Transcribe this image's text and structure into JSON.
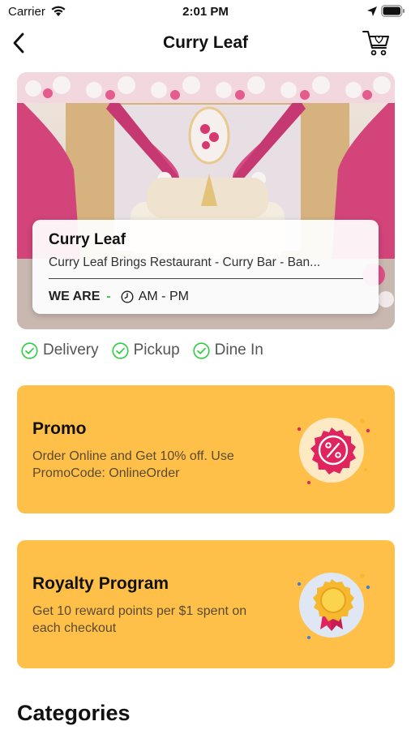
{
  "status_bar": {
    "carrier": "Carrier",
    "time": "2:01 PM"
  },
  "nav": {
    "title": "Curry Leaf"
  },
  "restaurant": {
    "name": "Curry Leaf",
    "description": "Curry Leaf Brings Restaurant - Curry Bar - Ban...",
    "open_label": "WE ARE",
    "open_status": "-",
    "hours": "AM - PM"
  },
  "services": [
    {
      "label": "Delivery"
    },
    {
      "label": "Pickup"
    },
    {
      "label": "Dine In"
    }
  ],
  "offers": [
    {
      "title": "Promo",
      "description": "Order Online and Get 10% off. Use PromoCode: OnlineOrder",
      "icon": "discount-badge-icon"
    },
    {
      "title": "Royalty Program",
      "description": "Get 10 reward points per $1 spent on each checkout",
      "icon": "award-medal-icon"
    }
  ],
  "section": {
    "categories_title": "Categories"
  },
  "colors": {
    "accent": "#ffc04a",
    "check": "#2ecc40",
    "badge": "#e0245e"
  }
}
